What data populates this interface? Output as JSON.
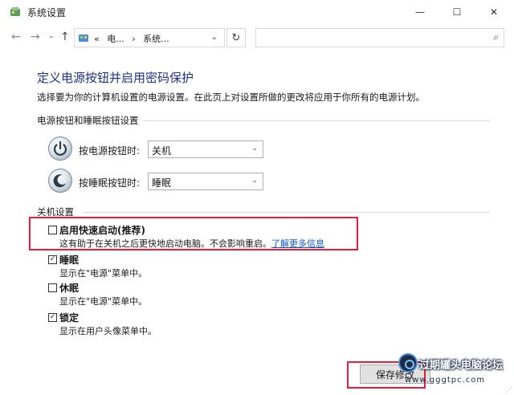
{
  "window": {
    "title": "系统设置",
    "minimize_glyph": "—",
    "maximize_glyph": "☐",
    "close_glyph": "✕"
  },
  "nav": {
    "back_glyph": "←",
    "forward_glyph": "→",
    "recent_glyph": "⌄",
    "up_glyph": "↑",
    "breadcrumb_prefix": "«",
    "breadcrumbs": [
      "电...",
      "系统..."
    ],
    "dropdown_glyph": "⌄",
    "refresh_glyph": "↻",
    "search_placeholder": "",
    "search_glyph": "⌕"
  },
  "page": {
    "heading": "定义电源按钮并启用密码保护",
    "description": "选择要为你的计算机设置的电源设置。在此页上对设置所做的更改将应用于你所有的电源计划。"
  },
  "power_section": {
    "title": "电源按钮和睡眠按钮设置",
    "power_button_label": "按电源按钮时:",
    "power_button_value": "关机",
    "sleep_button_label": "按睡眠按钮时:",
    "sleep_button_value": "睡眠",
    "select_arrow": "⌄"
  },
  "shutdown_section": {
    "title": "关机设置",
    "options": [
      {
        "label": "启用快速启动(推荐)",
        "checked": false,
        "description": "这有助于在关机之后更快地启动电脑。不会影响重启。",
        "link": "了解更多信息"
      },
      {
        "label": "睡眠",
        "checked": true,
        "description": "显示在\"电源\"菜单中。"
      },
      {
        "label": "休眠",
        "checked": false,
        "description": "显示在\"电源\"菜单中。"
      },
      {
        "label": "锁定",
        "checked": true,
        "description": "显示在用户头像菜单中。"
      }
    ]
  },
  "footer": {
    "save_label": "保存修改"
  },
  "watermark": {
    "text": "过期罐头电脑论坛",
    "url": "www.gggtpc.com"
  },
  "colors": {
    "heading": "#1e3287",
    "link": "#0b57c9",
    "highlight": "#e01f3d"
  }
}
